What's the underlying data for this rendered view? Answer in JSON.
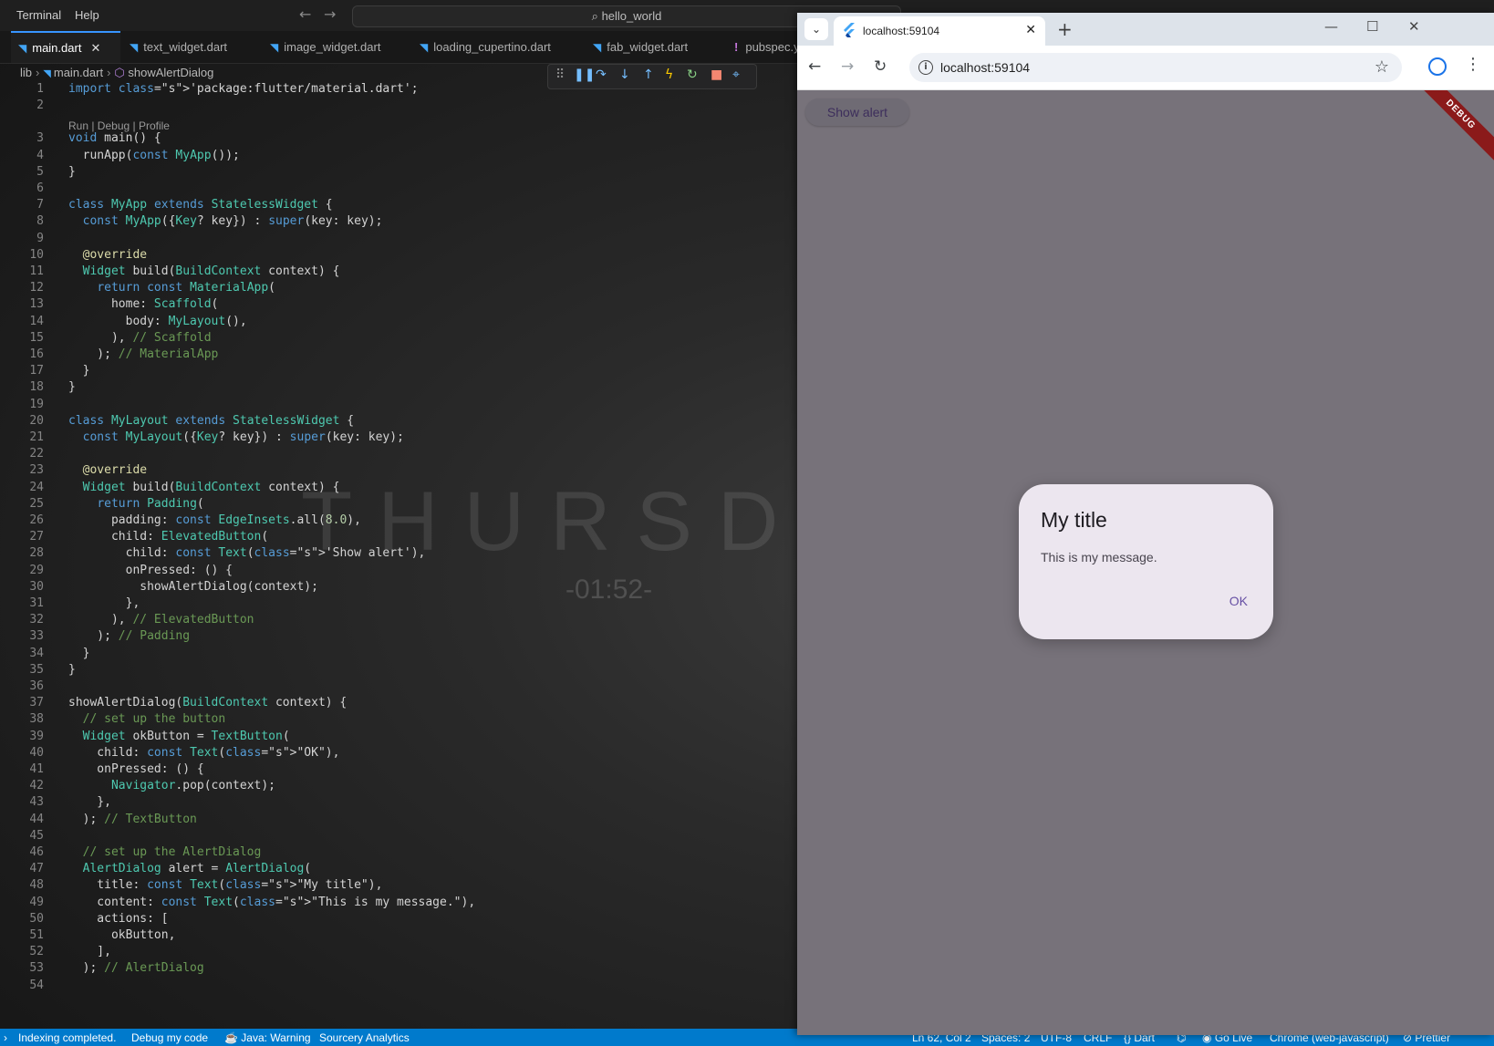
{
  "vscode": {
    "menu": [
      "Terminal",
      "Help"
    ],
    "command_center": "hello_world",
    "tabs": [
      {
        "label": "main.dart",
        "active": true
      },
      {
        "label": "text_widget.dart"
      },
      {
        "label": "image_widget.dart"
      },
      {
        "label": "loading_cupertino.dart"
      },
      {
        "label": "fab_widget.dart"
      },
      {
        "label": "pubspec.y"
      }
    ],
    "breadcrumb": [
      "lib",
      "main.dart",
      "showAlertDialog"
    ],
    "codelens": "Run | Debug | Profile",
    "watermark": {
      "word": "THURSDA",
      "time": "-01:52-"
    },
    "code": [
      "import 'package:flutter/material.dart';",
      "",
      "void main() {",
      "  runApp(const MyApp());",
      "}",
      "",
      "class MyApp extends StatelessWidget {",
      "  const MyApp({Key? key}) : super(key: key);",
      "",
      "  @override",
      "  Widget build(BuildContext context) {",
      "    return const MaterialApp(",
      "      home: Scaffold(",
      "        body: MyLayout(),",
      "      ), // Scaffold",
      "    ); // MaterialApp",
      "  }",
      "}",
      "",
      "class MyLayout extends StatelessWidget {",
      "  const MyLayout({Key? key}) : super(key: key);",
      "",
      "  @override",
      "  Widget build(BuildContext context) {",
      "    return Padding(",
      "      padding: const EdgeInsets.all(8.0),",
      "      child: ElevatedButton(",
      "        child: const Text('Show alert'),",
      "        onPressed: () {",
      "          showAlertDialog(context);",
      "        },",
      "      ), // ElevatedButton",
      "    ); // Padding",
      "  }",
      "}",
      "",
      "showAlertDialog(BuildContext context) {",
      "  // set up the button",
      "  Widget okButton = TextButton(",
      "    child: const Text(\"OK\"),",
      "    onPressed: () {",
      "      Navigator.pop(context);",
      "    },",
      "  ); // TextButton",
      "",
      "  // set up the AlertDialog",
      "  AlertDialog alert = AlertDialog(",
      "    title: const Text(\"My title\"),",
      "    content: const Text(\"This is my message.\"),",
      "    actions: [",
      "      okButton,",
      "    ],",
      "  ); // AlertDialog",
      ""
    ],
    "status": {
      "left": [
        "Indexing completed.",
        "Debug my code",
        "Java: Warning",
        "Sourcery Analytics"
      ],
      "right": [
        "Ln 62, Col 2",
        "Spaces: 2",
        "UTF-8",
        "CRLF",
        "{} Dart",
        "Go Live",
        "Chrome (web-javascript)",
        "Prettier"
      ]
    }
  },
  "chrome": {
    "tab_title": "localhost:59104",
    "url": "localhost:59104",
    "app": {
      "button_label": "Show alert",
      "debug_banner": "DEBUG",
      "dialog": {
        "title": "My title",
        "message": "This is my message.",
        "action": "OK"
      }
    }
  }
}
